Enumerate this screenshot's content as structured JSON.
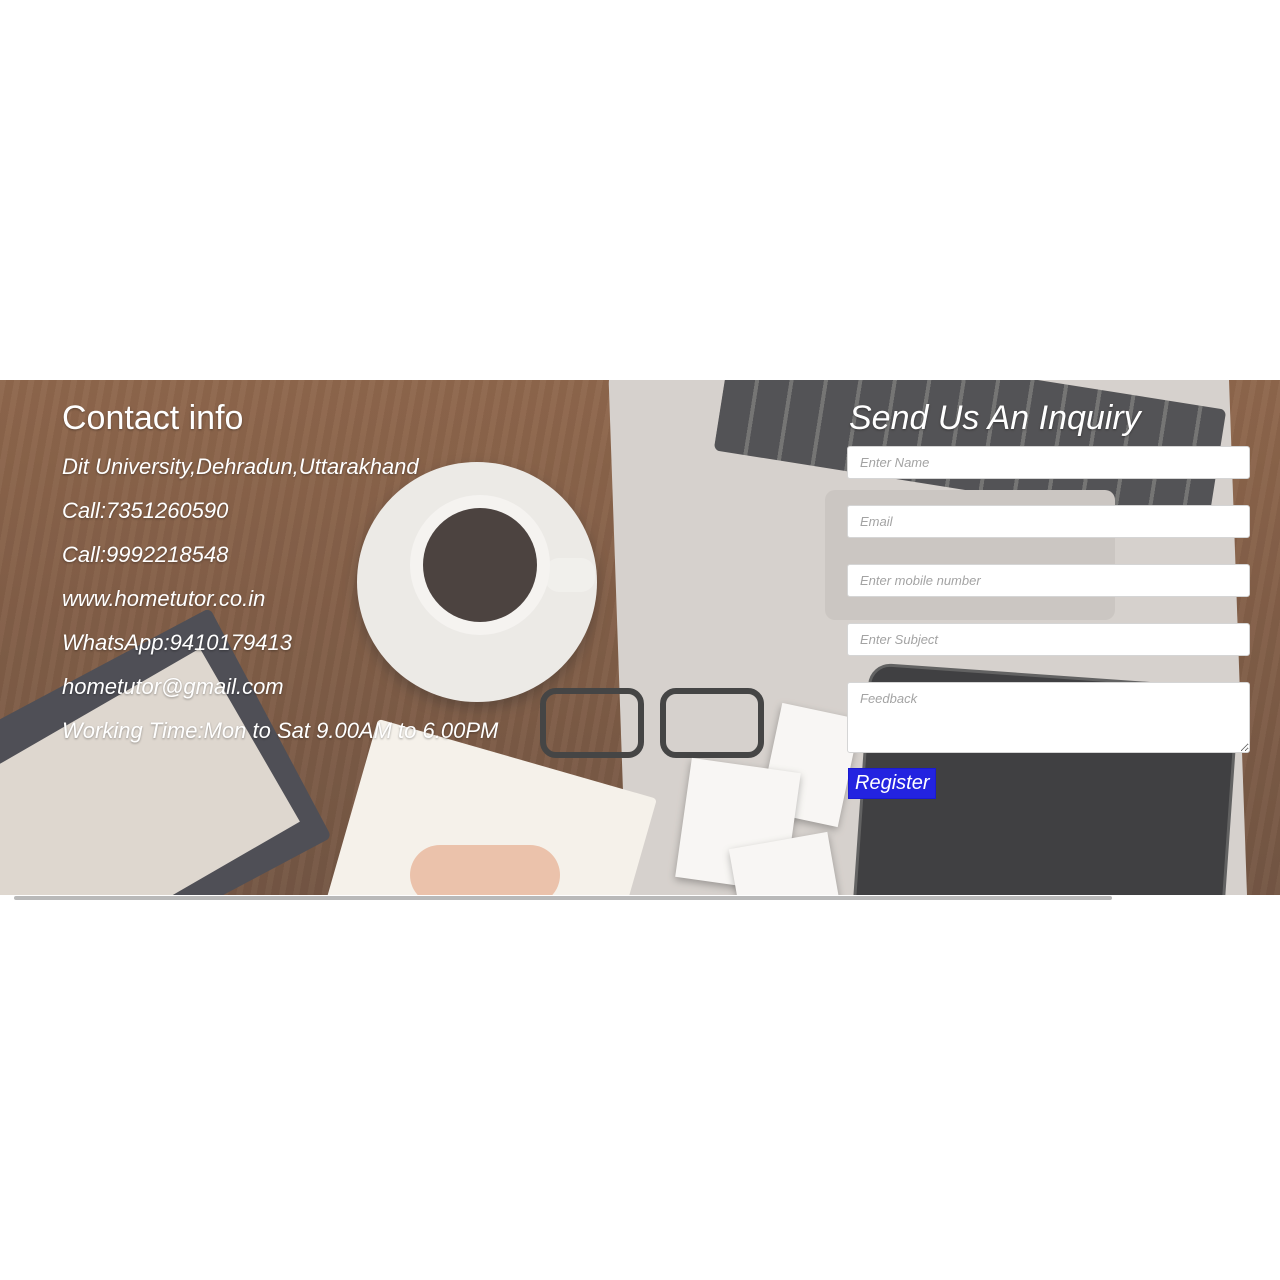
{
  "contact": {
    "title": "Contact info",
    "lines": [
      "Dit University,Dehradun,Uttarakhand",
      "Call:7351260590",
      "Call:9992218548",
      "www.hometutor.co.in",
      "WhatsApp:9410179413",
      "hometutor@gmail.com",
      "Working Time:Mon to Sat 9.00AM to 6.00PM"
    ]
  },
  "inquiry": {
    "title": "Send Us An Inquiry",
    "name_placeholder": "Enter Name",
    "email_placeholder": "Email",
    "mobile_placeholder": "Enter mobile number",
    "subject_placeholder": "Enter Subject",
    "feedback_placeholder": "Feedback",
    "submit_label": "Register"
  },
  "colors": {
    "button": "#2323e0",
    "text_on_image": "#ffffff"
  }
}
